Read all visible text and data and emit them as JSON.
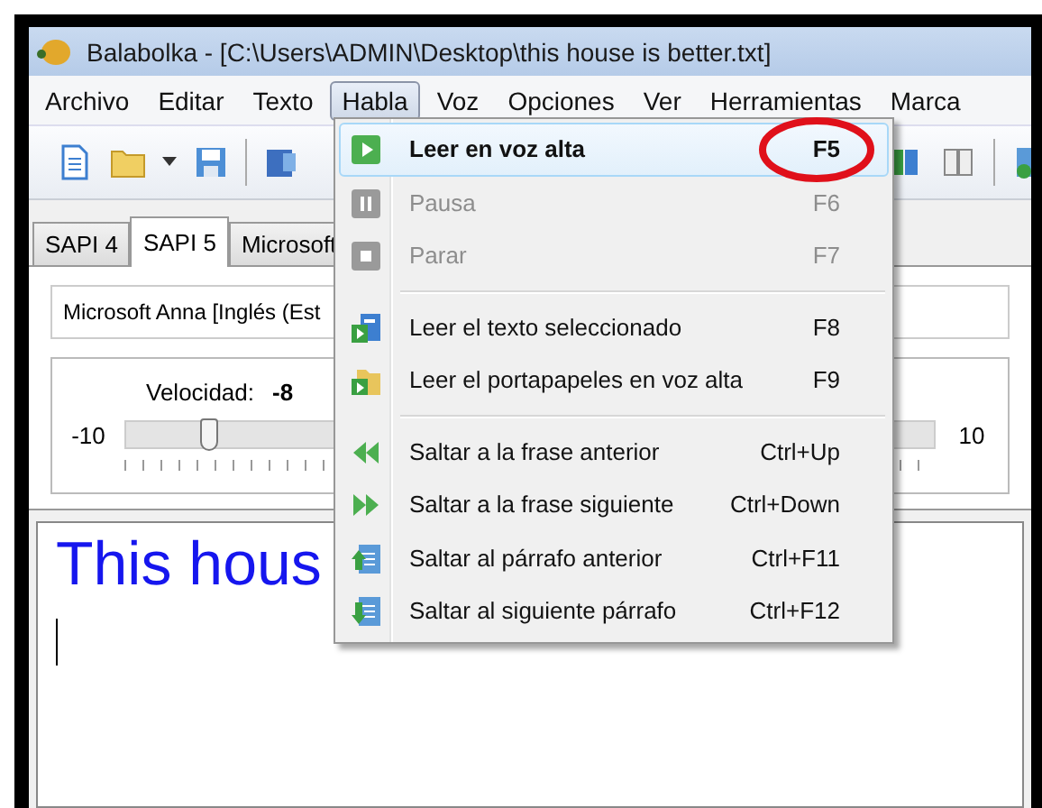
{
  "window": {
    "title": "Balabolka - [C:\\Users\\ADMIN\\Desktop\\this house is better.txt]"
  },
  "menu_bar": [
    {
      "label": "Archivo",
      "selected": false
    },
    {
      "label": "Editar",
      "selected": false
    },
    {
      "label": "Texto",
      "selected": false
    },
    {
      "label": "Habla",
      "selected": true
    },
    {
      "label": "Voz",
      "selected": false
    },
    {
      "label": "Opciones",
      "selected": false
    },
    {
      "label": "Ver",
      "selected": false
    },
    {
      "label": "Herramientas",
      "selected": false
    },
    {
      "label": "Marca",
      "selected": false
    }
  ],
  "tabs": [
    {
      "label": "SAPI 4",
      "selected": false
    },
    {
      "label": "SAPI 5",
      "selected": true
    },
    {
      "label": "Microsoft",
      "selected": false
    }
  ],
  "voice": {
    "value": "Microsoft Anna [Inglés (Est"
  },
  "rate": {
    "label": "Velocidad:",
    "reading": "-8",
    "min": "-10",
    "max": "10",
    "level": 0.1
  },
  "editor": {
    "text": "This hous"
  },
  "dropdown_menu": [
    {
      "kind": "item",
      "label": "Leer en voz alta",
      "shortcut": "F5",
      "disabled": false,
      "selected": true
    },
    {
      "kind": "item",
      "label": "Pausa",
      "shortcut": "F6",
      "disabled": true,
      "selected": false
    },
    {
      "kind": "item",
      "label": "Parar",
      "shortcut": "F7",
      "disabled": true,
      "selected": false
    },
    {
      "kind": "separator"
    },
    {
      "kind": "item",
      "label": "Leer el texto seleccionado",
      "shortcut": "F8",
      "disabled": false,
      "selected": false
    },
    {
      "kind": "item",
      "label": "Leer el portapapeles en voz alta",
      "shortcut": "F9",
      "disabled": false,
      "selected": false
    },
    {
      "kind": "separator"
    },
    {
      "kind": "item",
      "label": "Saltar a la frase anterior",
      "shortcut": "Ctrl+Up",
      "disabled": false,
      "selected": false
    },
    {
      "kind": "item",
      "label": "Saltar a la frase siguiente",
      "shortcut": "Ctrl+Down",
      "disabled": false,
      "selected": false
    },
    {
      "kind": "item",
      "label": "Saltar al párrafo anterior",
      "shortcut": "Ctrl+F11",
      "disabled": false,
      "selected": false
    },
    {
      "kind": "item",
      "label": "Saltar al siguiente párrafo",
      "shortcut": "Ctrl+F12",
      "disabled": false,
      "selected": false
    }
  ]
}
